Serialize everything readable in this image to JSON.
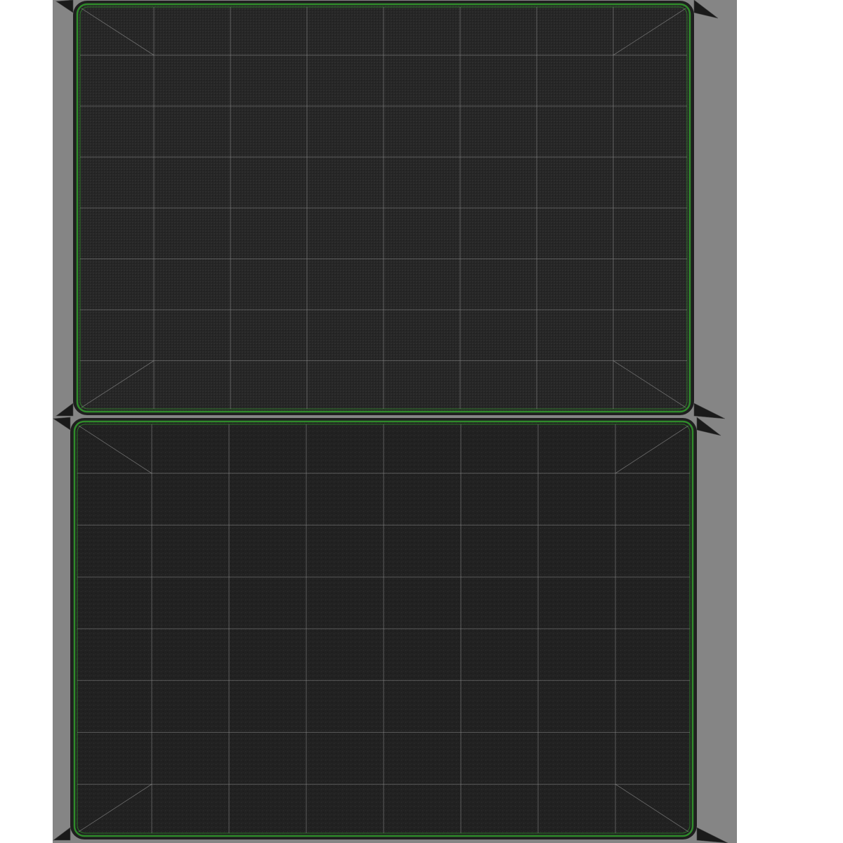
{
  "colors": {
    "page_background": "#ffffff",
    "sheet_background": "#858585",
    "panel_fill": "#262626",
    "panel_fill_lower": "#222222",
    "grid_line": "#8a8a8a",
    "border_outline": "#2f8a2a",
    "border_shading": "#0d0d0d"
  },
  "panels": [
    {
      "id": "top-panel",
      "texture": "woven-knit",
      "grid": {
        "columns": 8,
        "rows": 8
      }
    },
    {
      "id": "bottom-panel",
      "texture": "felt",
      "grid": {
        "columns": 8,
        "rows": 8
      }
    }
  ]
}
